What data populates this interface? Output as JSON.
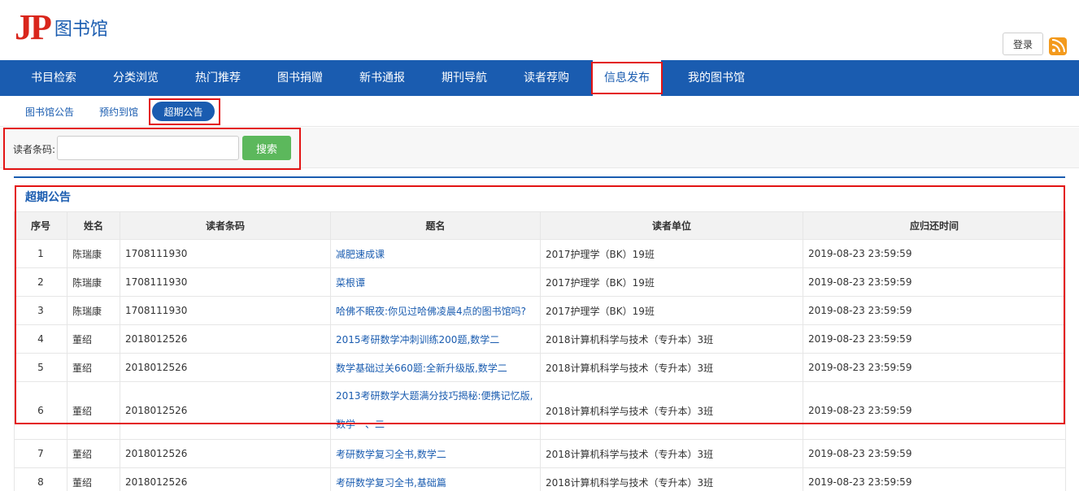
{
  "brand": {
    "logo": "JP",
    "name": "图书馆"
  },
  "header": {
    "login_label": "登录"
  },
  "nav": {
    "items": [
      {
        "label": "书目检索"
      },
      {
        "label": "分类浏览"
      },
      {
        "label": "热门推荐"
      },
      {
        "label": "图书捐赠"
      },
      {
        "label": "新书通报"
      },
      {
        "label": "期刊导航"
      },
      {
        "label": "读者荐购"
      },
      {
        "label": "信息发布"
      },
      {
        "label": "我的图书馆"
      }
    ]
  },
  "subnav": {
    "items": [
      {
        "label": "图书馆公告"
      },
      {
        "label": "预约到馆"
      },
      {
        "label": "超期公告"
      }
    ]
  },
  "search": {
    "label": "读者条码:",
    "value": "",
    "button": "搜索"
  },
  "section": {
    "title": "超期公告"
  },
  "table": {
    "headers": [
      "序号",
      "姓名",
      "读者条码",
      "题名",
      "读者单位",
      "应归还时间"
    ],
    "rows": [
      [
        "1",
        "陈瑞康",
        "1708111930",
        "减肥速成课",
        "2017护理学（BK）19班",
        "2019-08-23 23:59:59"
      ],
      [
        "2",
        "陈瑞康",
        "1708111930",
        "菜根谭",
        "2017护理学（BK）19班",
        "2019-08-23 23:59:59"
      ],
      [
        "3",
        "陈瑞康",
        "1708111930",
        "哈佛不眠夜:你见过哈佛凌晨4点的图书馆吗?",
        "2017护理学（BK）19班",
        "2019-08-23 23:59:59"
      ],
      [
        "4",
        "董绍",
        "2018012526",
        "2015考研数学冲刺训练200题,数学二",
        "2018计算机科学与技术（专升本）3班",
        "2019-08-23 23:59:59"
      ],
      [
        "5",
        "董绍",
        "2018012526",
        "数学基础过关660题:全新升级版,数学二",
        "2018计算机科学与技术（专升本）3班",
        "2019-08-23 23:59:59"
      ],
      [
        "6",
        "董绍",
        "2018012526",
        "2013考研数学大题满分技巧揭秘:便携记忆版,数学一、二",
        "2018计算机科学与技术（专升本）3班",
        "2019-08-23 23:59:59"
      ],
      [
        "7",
        "董绍",
        "2018012526",
        "考研数学复习全书,数学二",
        "2018计算机科学与技术（专升本）3班",
        "2019-08-23 23:59:59"
      ],
      [
        "8",
        "董绍",
        "2018012526",
        "考研数学复习全书,基础篇",
        "2018计算机科学与技术（专升本）3班",
        "2019-08-23 23:59:59"
      ]
    ]
  },
  "colors": {
    "brand_blue": "#1a5cb0",
    "logo_red": "#d9261c",
    "highlight_red": "#e31414",
    "search_green": "#5cb85c",
    "rss_orange": "#f39a1d"
  },
  "icons": {
    "rss": "rss-icon"
  }
}
